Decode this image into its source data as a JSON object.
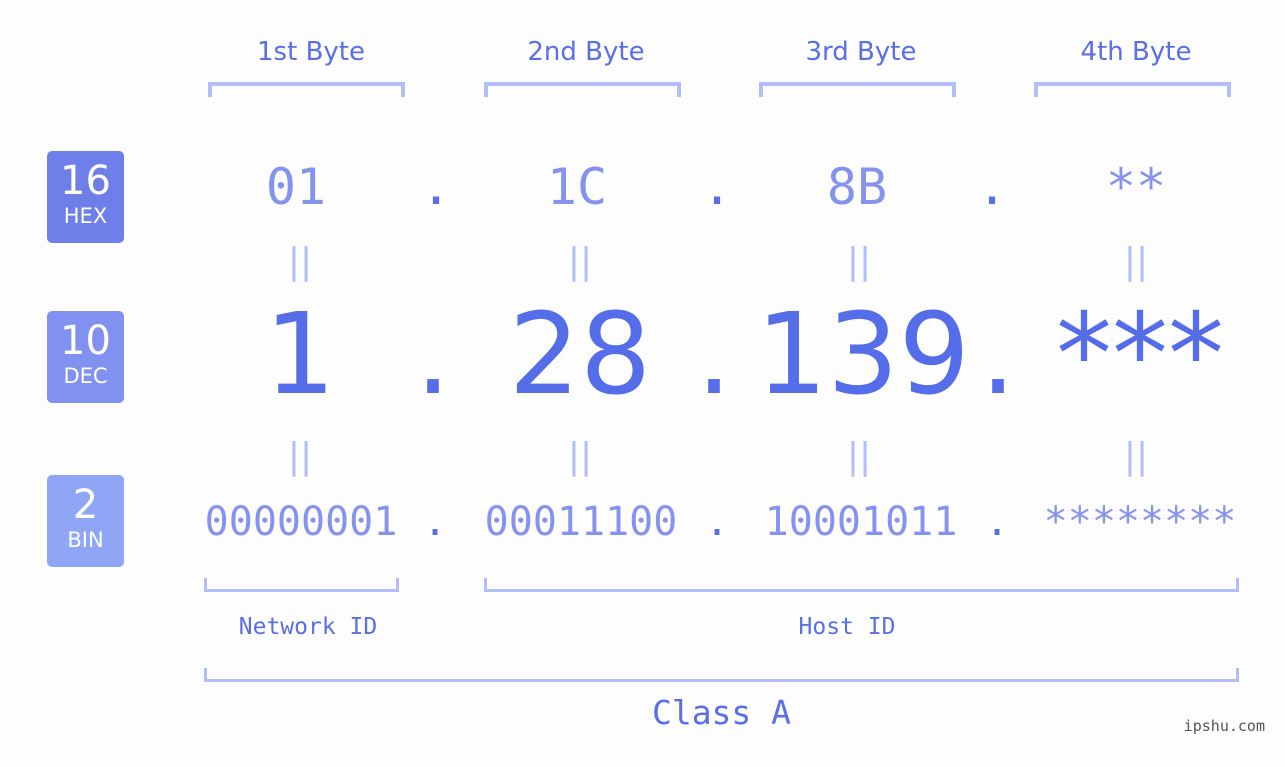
{
  "colors": {
    "hex_badge": "#6f7fea",
    "dec_badge": "#8191f0",
    "bin_badge": "#8fa6f6",
    "accent": "#566de9",
    "light_text": "#8593ef",
    "bracket": "#b3bdf7",
    "background": "#fcfdfc"
  },
  "bases": [
    {
      "number": "16",
      "label": "HEX"
    },
    {
      "number": "10",
      "label": "DEC"
    },
    {
      "number": "2",
      "label": "BIN"
    }
  ],
  "byte_headers": [
    "1st Byte",
    "2nd Byte",
    "3rd Byte",
    "4th Byte"
  ],
  "separator": ".",
  "equals_sign": "||",
  "hex_values": [
    "01",
    "1C",
    "8B",
    "**"
  ],
  "dec_values": [
    "1",
    "28",
    "139",
    "***"
  ],
  "bin_values": [
    "00000001",
    "00011100",
    "10001011",
    "********"
  ],
  "network_id_label": "Network ID",
  "host_id_label": "Host ID",
  "class_label": "Class A",
  "watermark": "ipshu.com"
}
